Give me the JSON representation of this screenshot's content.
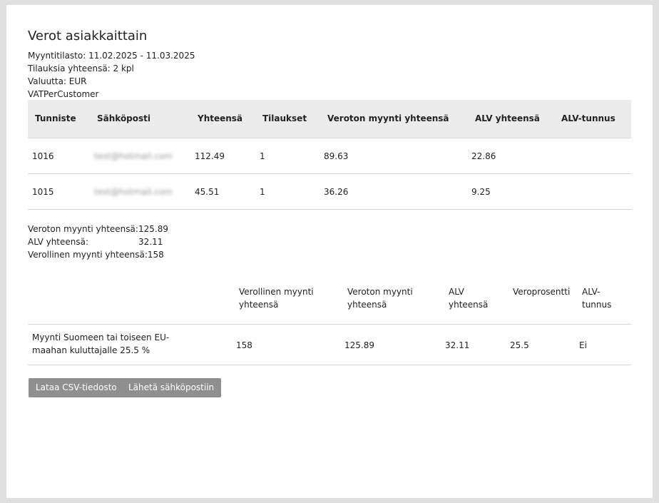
{
  "header": {
    "title": "Verot asiakkaittain"
  },
  "meta": {
    "period": "Myyntitilasto: 11.02.2025 - 11.03.2025",
    "orders": "Tilauksia yhteensä: 2 kpl",
    "currency": "Valuutta: EUR",
    "report_id": "VATPerCustomer"
  },
  "customers_table": {
    "columns": [
      "Tunniste",
      "Sähköposti",
      "Yhteensä",
      "Tilaukset",
      "Veroton myynti yhteensä",
      "ALV yhteensä",
      "ALV-tunnus"
    ],
    "rows": [
      {
        "id": "1016",
        "email": "test@hotmail.com",
        "total": "112.49",
        "orders": "1",
        "net": "89.63",
        "vat": "22.86",
        "vat_id": ""
      },
      {
        "id": "1015",
        "email": "test@hotmail.com",
        "total": "45.51",
        "orders": "1",
        "net": "36.26",
        "vat": "9.25",
        "vat_id": ""
      }
    ]
  },
  "totals": {
    "net_label": "Veroton myynti yhteensä:",
    "net_value": "125.89",
    "vat_label": "ALV yhteensä:",
    "vat_value": "32.11",
    "gross_label": "Verollinen myynti yhteensä:",
    "gross_value": "158"
  },
  "rates_table": {
    "columns": [
      "",
      "Verollinen myynti yhteensä",
      "Veroton myynti yhteensä",
      "ALV yhteensä",
      "Veroprosentti",
      "ALV-tunnus"
    ],
    "rows": [
      {
        "desc": "Myynti Suomeen tai toiseen EU-maahan kuluttajalle 25.5 %",
        "gross": "158",
        "net": "125.89",
        "vat": "32.11",
        "rate": "25.5",
        "vat_id": "Ei"
      }
    ]
  },
  "actions": {
    "csv_label": "Lataa CSV-tiedosto",
    "email_label": "Lähetä sähköpostiin"
  },
  "colors": {
    "header_bg": "#ececec",
    "button_bg": "#8f8f8f",
    "page_bg": "#e0e0e0"
  }
}
